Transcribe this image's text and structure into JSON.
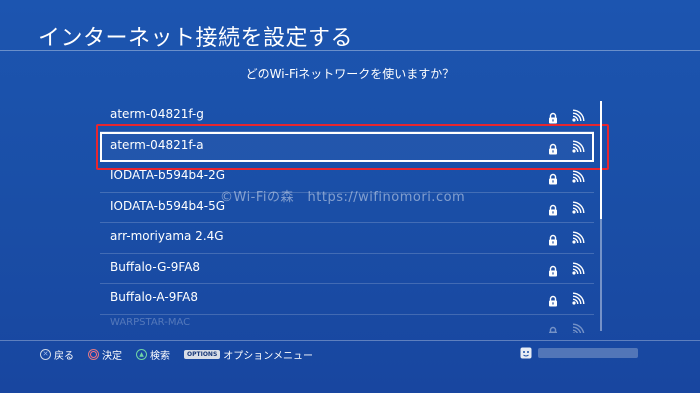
{
  "header": {
    "title": "インターネット接続を設定する"
  },
  "prompt": "どのWi-Fiネットワークを使いますか？",
  "networks": [
    {
      "ssid": "aterm-04821f-g",
      "secured": true,
      "signal": "strong"
    },
    {
      "ssid": "aterm-04821f-a",
      "secured": true,
      "signal": "strong"
    },
    {
      "ssid": "IODATA-b594b4-2G",
      "secured": true,
      "signal": "strong"
    },
    {
      "ssid": "IODATA-b594b4-5G",
      "secured": true,
      "signal": "strong"
    },
    {
      "ssid": "arr-moriyama 2.4G",
      "secured": true,
      "signal": "strong"
    },
    {
      "ssid": "Buffalo-G-9FA8",
      "secured": true,
      "signal": "strong"
    },
    {
      "ssid": "Buffalo-A-9FA8",
      "secured": true,
      "signal": "strong"
    },
    {
      "ssid": "WARPSTAR-MAC",
      "secured": true,
      "signal": "strong"
    }
  ],
  "selected_index": 1,
  "watermark": "©Wi-Fiの森　https://wifinomori.com",
  "footer": {
    "back": "戻る",
    "confirm": "決定",
    "search": "検索",
    "options_button": "OPTIONS",
    "options_menu": "オプションメニュー"
  },
  "colors": {
    "background": "#1a4ea6",
    "highlight_frame": "#e8262f",
    "selection_border": "#ffffff"
  },
  "icons": {
    "lock": "lock-icon",
    "wifi": "wifi-signal-icon",
    "user": "user-face-icon"
  }
}
